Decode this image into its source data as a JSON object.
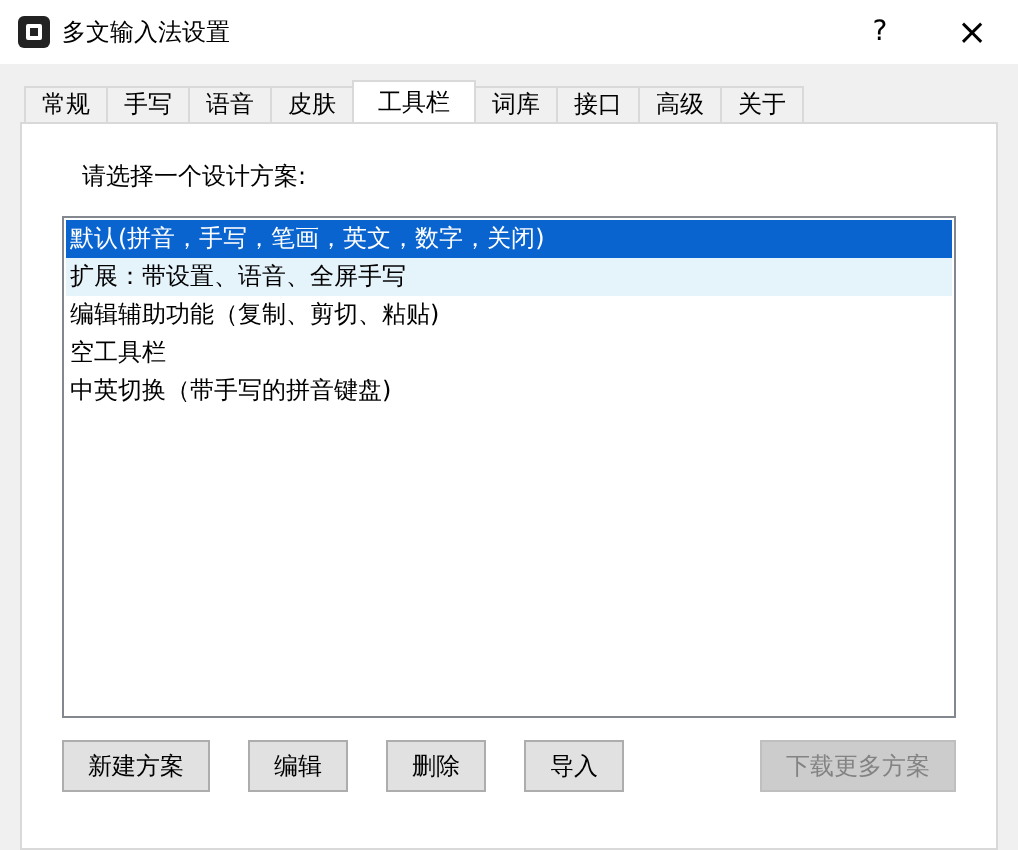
{
  "window": {
    "title": "多文输入法设置",
    "help": "?",
    "close": "×"
  },
  "tabs": [
    {
      "label": "常规",
      "selected": false
    },
    {
      "label": "手写",
      "selected": false
    },
    {
      "label": "语音",
      "selected": false
    },
    {
      "label": "皮肤",
      "selected": false
    },
    {
      "label": "工具栏",
      "selected": true
    },
    {
      "label": "词库",
      "selected": false
    },
    {
      "label": "接口",
      "selected": false
    },
    {
      "label": "高级",
      "selected": false
    },
    {
      "label": "关于",
      "selected": false
    }
  ],
  "prompt": "请选择一个设计方案:",
  "schemes": [
    {
      "label": "默认(拼音，手写，笔画，英文，数字，关闭)",
      "selected": true,
      "hovered": false
    },
    {
      "label": "扩展：带设置、语音、全屏手写",
      "selected": false,
      "hovered": true
    },
    {
      "label": "编辑辅助功能（复制、剪切、粘贴)",
      "selected": false,
      "hovered": false
    },
    {
      "label": "空工具栏",
      "selected": false,
      "hovered": false
    },
    {
      "label": "中英切换（带手写的拼音键盘)",
      "selected": false,
      "hovered": false
    }
  ],
  "buttons": [
    {
      "label": "新建方案",
      "disabled": false
    },
    {
      "label": "编辑",
      "disabled": false
    },
    {
      "label": "删除",
      "disabled": false
    },
    {
      "label": "导入",
      "disabled": false
    },
    {
      "label": "下载更多方案",
      "disabled": true
    }
  ]
}
